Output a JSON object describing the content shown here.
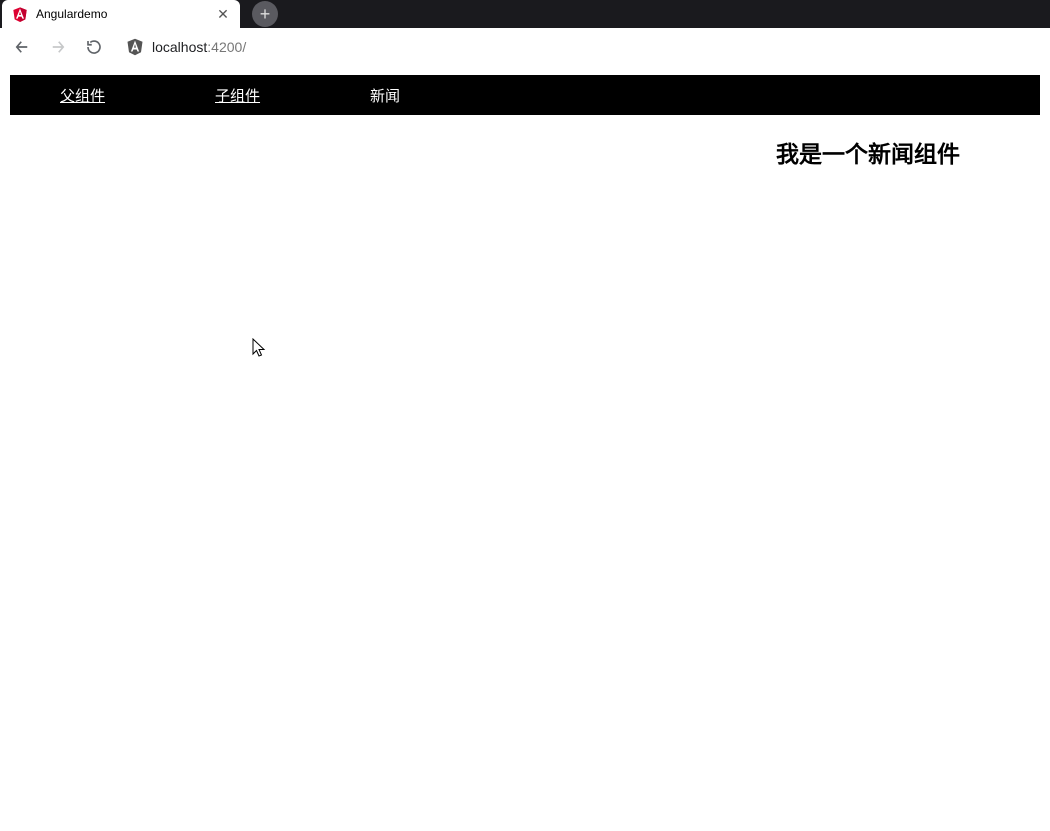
{
  "browser": {
    "tab_title": "Angulardemo",
    "url_host": "localhost",
    "url_port": ":4200",
    "url_path": "/"
  },
  "nav": {
    "items": [
      {
        "label": "父组件",
        "underline": true
      },
      {
        "label": "子组件",
        "underline": true
      },
      {
        "label": "新闻",
        "underline": false
      }
    ]
  },
  "content": {
    "heading": "我是一个新闻组件"
  }
}
